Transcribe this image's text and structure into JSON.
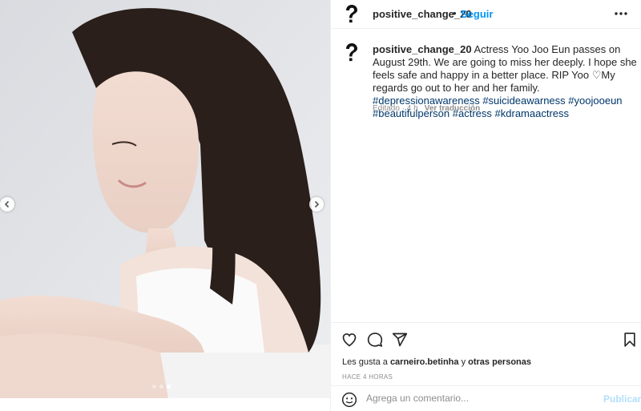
{
  "post": {
    "username": "positive_change_20",
    "separator": "•",
    "follow_label": "Seguir",
    "more_icon": "more-horizontal-icon",
    "caption": {
      "username": "positive_change_20",
      "line1": "Actress Yoo Joo Eun passes on August 29th.",
      "line2": "We are going to miss her deeply. I hope she feels safe and happy",
      "line3": "in a better place. RIP Yoo ",
      "emoji": "♡",
      "line3b": "My regards go out to her and her",
      "line4": "family. ",
      "hashtags": [
        "#depressionawareness",
        "#suicideawarness",
        "#yoojooeun",
        "#beautifulperson",
        "#actress",
        "#kdramaactress"
      ]
    },
    "meta": {
      "edited": "Editado · 4 h",
      "translate": "Ver traducción"
    },
    "likes": {
      "prefix": "Les gusta a",
      "user": "carneiro.betinha",
      "joiner": "y",
      "others": "otras personas"
    },
    "time_ago": "HACE 4 HORAS",
    "comment": {
      "placeholder": "Agrega un comentario...",
      "publish_label": "Publicar"
    }
  },
  "carousel": {
    "total": 3,
    "active_index": 2
  },
  "colors": {
    "accent": "#0095f6",
    "hashtag": "#00376b",
    "muted": "#8e8e8e",
    "publish_disabled": "#b2dffc"
  }
}
